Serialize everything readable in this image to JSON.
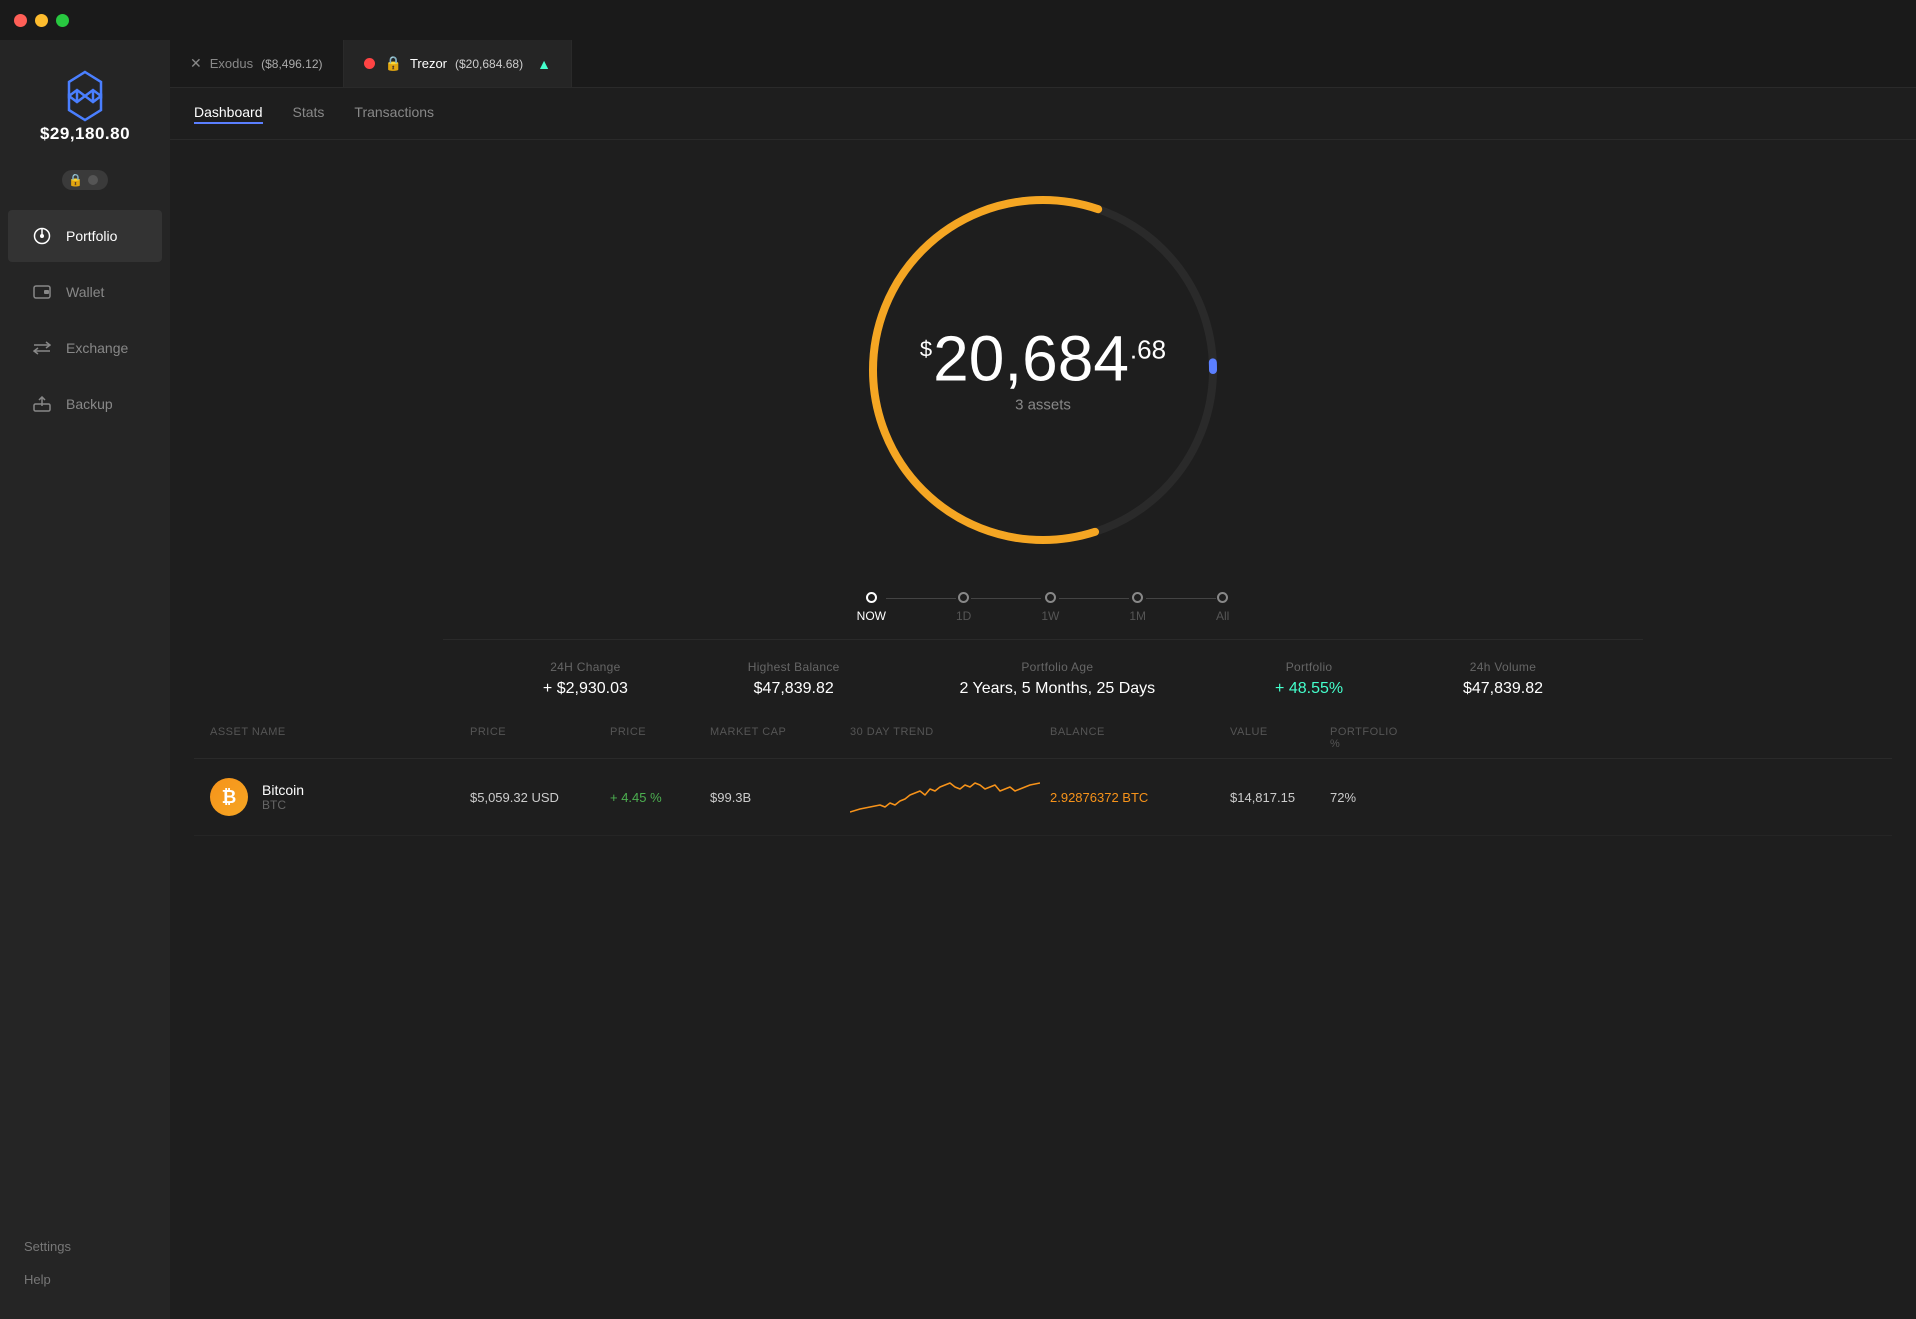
{
  "titlebar": {
    "dots": [
      "red",
      "yellow",
      "green"
    ]
  },
  "sidebar": {
    "total": "$29,180.80",
    "nav_items": [
      {
        "id": "portfolio",
        "label": "Portfolio",
        "icon": "🕐",
        "active": true
      },
      {
        "id": "wallet",
        "label": "Wallet",
        "icon": "▭",
        "active": false
      },
      {
        "id": "exchange",
        "label": "Exchange",
        "icon": "⇄",
        "active": false
      },
      {
        "id": "backup",
        "label": "Backup",
        "icon": "⤓",
        "active": false
      }
    ],
    "bottom_items": [
      {
        "id": "settings",
        "label": "Settings"
      },
      {
        "id": "help",
        "label": "Help"
      }
    ]
  },
  "accounts_bar": {
    "tabs": [
      {
        "id": "exodus",
        "label": "Exodus",
        "amount": "($8,496.12)",
        "active": false,
        "icon": "✕",
        "has_indicator": false
      },
      {
        "id": "trezor",
        "label": "Trezor",
        "amount": "($20,684.68)",
        "active": true,
        "icon": "🔒",
        "has_indicator": true
      }
    ],
    "expand_icon": "▲"
  },
  "subnav": {
    "items": [
      {
        "id": "dashboard",
        "label": "Dashboard",
        "active": true
      },
      {
        "id": "stats",
        "label": "Stats",
        "active": false
      },
      {
        "id": "transactions",
        "label": "Transactions",
        "active": false
      }
    ]
  },
  "donut": {
    "dollar_sign": "$",
    "main_amount": "20,684",
    "cents": ".68",
    "subtitle": "3 assets",
    "blue_color": "#5b7fff",
    "gold_color": "#f5a623"
  },
  "time_selector": {
    "items": [
      {
        "id": "now",
        "label": "NOW",
        "active": true
      },
      {
        "id": "1d",
        "label": "1D",
        "active": false
      },
      {
        "id": "1w",
        "label": "1W",
        "active": false
      },
      {
        "id": "1m",
        "label": "1M",
        "active": false
      },
      {
        "id": "all",
        "label": "All",
        "active": false
      }
    ]
  },
  "stats": {
    "items": [
      {
        "id": "24h_change",
        "label": "24H Change",
        "value": "+ $2,930.03",
        "positive": false
      },
      {
        "id": "highest_balance",
        "label": "Highest Balance",
        "value": "$47,839.82",
        "positive": false
      },
      {
        "id": "portfolio_age",
        "label": "Portfolio Age",
        "value": "2 Years, 5 Months, 25 Days",
        "positive": false
      },
      {
        "id": "portfolio",
        "label": "Portfolio",
        "value": "+ 48.55%",
        "positive": true
      },
      {
        "id": "24h_volume",
        "label": "24h Volume",
        "value": "$47,839.82",
        "positive": false
      }
    ]
  },
  "asset_table": {
    "headers": [
      "ASSET NAME",
      "PRICE",
      "PRICE",
      "MARKET CAP",
      "30 DAY TREND",
      "BALANCE",
      "VALUE",
      "PORTFOLIO %"
    ],
    "rows": [
      {
        "id": "btc",
        "name": "Bitcoin",
        "symbol": "BTC",
        "logo": "₿",
        "logo_bg": "#f7931a",
        "price_usd": "$5,059.32 USD",
        "price_change": "+ 4.45 %",
        "market_cap": "$99.3B",
        "balance": "2.92876372 BTC",
        "value": "$14,817.15",
        "portfolio_pct": "72%",
        "trend_color": "#f7931a"
      }
    ]
  }
}
